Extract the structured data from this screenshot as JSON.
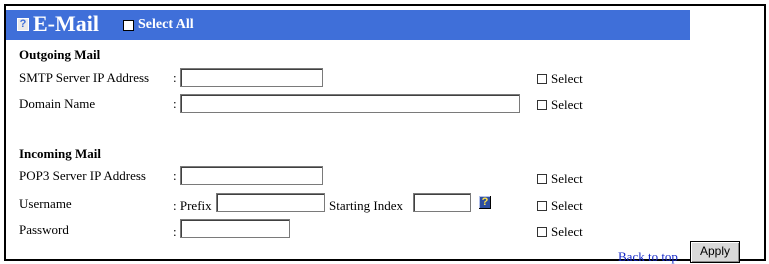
{
  "header": {
    "help_glyph": "?",
    "title": "E-Mail",
    "select_all_label": "Select All",
    "bar_color": "#3f6fd9"
  },
  "outgoing": {
    "heading": "Outgoing Mail",
    "smtp_label": "SMTP Server IP Address",
    "smtp_value": "",
    "domain_label": "Domain Name",
    "domain_value": ""
  },
  "incoming": {
    "heading": "Incoming Mail",
    "pop3_label": "POP3 Server IP Address",
    "pop3_value": "",
    "username_label": "Username",
    "prefix_label": ": Prefix",
    "prefix_value": "",
    "starting_index_label": "Starting Index",
    "starting_index_value": "",
    "password_label": "Password",
    "password_value": ""
  },
  "colon": ":",
  "select_label": "Select",
  "help_glyph": "?",
  "footer": {
    "back_to_top": "Back to top",
    "apply_label": "Apply"
  }
}
